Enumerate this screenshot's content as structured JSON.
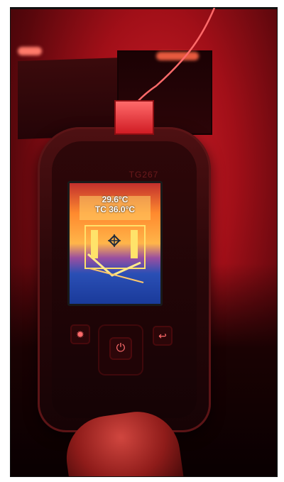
{
  "device": {
    "model_label": "TG267",
    "readout_primary": "29.6°C",
    "readout_secondary": "TC 36.0°C"
  },
  "buttons": {
    "laser_icon": "laser-icon",
    "back_icon": "back-arrow-icon",
    "power_icon": "power-icon"
  },
  "colors": {
    "ambient_red": "#d2202a",
    "thermal_hot": "#ffe35a",
    "thermal_cool": "#1f4aa8"
  }
}
